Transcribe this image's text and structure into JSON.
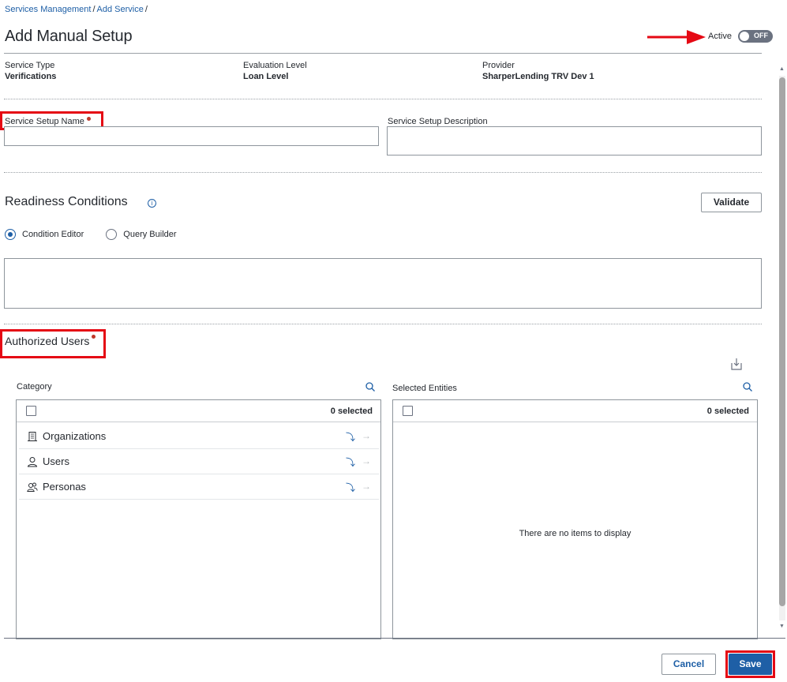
{
  "breadcrumb": {
    "items": [
      "Services Management",
      "Add Service"
    ],
    "separator": "/"
  },
  "page": {
    "title": "Add Manual Setup"
  },
  "active_toggle": {
    "label": "Active",
    "state": "OFF"
  },
  "service_info": {
    "service_type": {
      "label": "Service Type",
      "value": "Verifications"
    },
    "evaluation_level": {
      "label": "Evaluation Level",
      "value": "Loan Level"
    },
    "provider": {
      "label": "Provider",
      "value": "SharperLending TRV Dev 1"
    }
  },
  "fields": {
    "setup_name": {
      "label": "Service Setup Name",
      "value": "",
      "required": true
    },
    "setup_description": {
      "label": "Service Setup Description",
      "value": ""
    }
  },
  "readiness": {
    "title": "Readiness Conditions",
    "info_icon": "info-icon",
    "validate_label": "Validate",
    "modes": [
      {
        "label": "Condition Editor",
        "selected": true
      },
      {
        "label": "Query Builder",
        "selected": false
      }
    ],
    "editor_value": ""
  },
  "authorized_users": {
    "title": "Authorized Users",
    "required": true,
    "export_icon": "export-icon",
    "category_panel": {
      "label": "Category",
      "selected_count": "0 selected",
      "items": [
        {
          "label": "Organizations",
          "icon": "building-icon"
        },
        {
          "label": "Users",
          "icon": "user-icon"
        },
        {
          "label": "Personas",
          "icon": "users-icon"
        }
      ]
    },
    "selected_panel": {
      "label": "Selected Entities",
      "selected_count": "0 selected",
      "empty_message": "There are no items to display"
    }
  },
  "footer": {
    "cancel_label": "Cancel",
    "save_label": "Save"
  },
  "colors": {
    "accent": "#1e5fa6",
    "annotation_red": "#e50914",
    "required_dot": "#c0392b"
  }
}
